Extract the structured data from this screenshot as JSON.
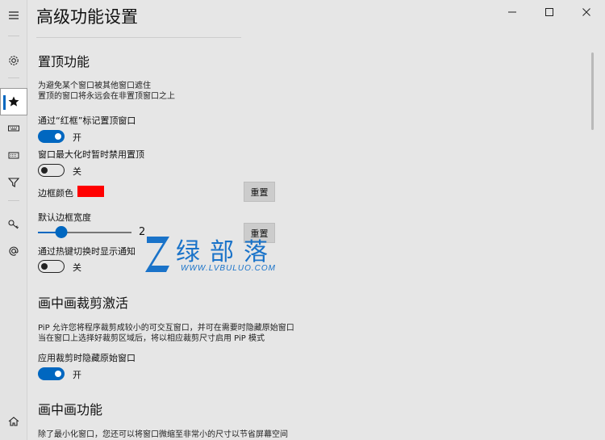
{
  "page": {
    "title": "高级功能设置"
  },
  "window_controls": {
    "minimize_icon": "minimize-icon",
    "maximize_icon": "maximize-icon",
    "close_icon": "close-icon"
  },
  "rail": {
    "items": [
      {
        "icon": "hamburger-menu-icon"
      },
      {
        "icon": "gear-icon"
      },
      {
        "icon": "star-icon",
        "active": true
      },
      {
        "icon": "keyboard-icon"
      },
      {
        "icon": "keyboard-small-icon"
      },
      {
        "icon": "filter-icon"
      },
      {
        "icon": "key-icon"
      },
      {
        "icon": "at-icon"
      },
      {
        "icon": "home-icon"
      }
    ]
  },
  "topmost": {
    "title": "置顶功能",
    "desc_line1": "为避免某个窗口被其他窗口遮住",
    "desc_line2": "置顶的窗口将永远会在非置顶窗口之上",
    "mark_red_frame": {
      "label": "通过“红框”标记置顶窗口",
      "state": "开",
      "on": true
    },
    "disable_when_maximized": {
      "label": "窗口最大化时暂时禁用置顶",
      "state": "关",
      "on": false
    },
    "border_color": {
      "label": "边框颜色",
      "value": "#ff0000",
      "reset": "重置"
    },
    "border_width": {
      "label": "默认边框宽度",
      "value": 2,
      "min": 1,
      "max": 5,
      "reset": "重置"
    },
    "hotkey_notify": {
      "label": "通过热键切换时显示通知",
      "state": "关",
      "on": false
    }
  },
  "pip_crop": {
    "title": "画中画裁剪激活",
    "desc_line1": "PiP 允许您将程序裁剪成较小的可交互窗口，并可在需要时隐藏原始窗口",
    "desc_line2": "当在窗口上选择好裁剪区域后，将以相应裁剪尺寸启用 PiP 模式",
    "hide_original": {
      "label": "应用裁剪时隐藏原始窗口",
      "state": "开",
      "on": true
    }
  },
  "pip": {
    "title": "画中画功能",
    "desc_line1": "除了最小化窗口，您还可以将窗口微缩至非常小的尺寸以节省屏幕空间"
  },
  "watermark": {
    "text": "绿部落",
    "url": "WWW.LVBULUO.COM"
  },
  "colors": {
    "accent": "#0067c0",
    "border_color_swatch": "#ff0000",
    "watermark": "#1a73c9"
  }
}
